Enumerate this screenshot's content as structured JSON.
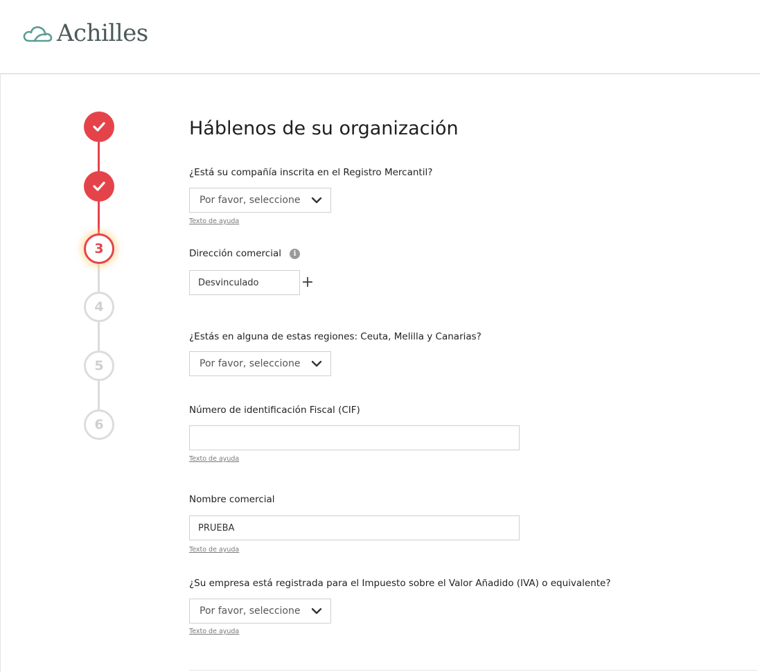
{
  "brand": {
    "name": "Achilles",
    "logo_icon": "cloud-icon",
    "accent_color": "#e5434a"
  },
  "stepper": {
    "steps": [
      {
        "label": "",
        "state": "done",
        "icon": "check-icon"
      },
      {
        "label": "",
        "state": "done",
        "icon": "check-icon"
      },
      {
        "label": "3",
        "state": "current"
      },
      {
        "label": "4",
        "state": "pending"
      },
      {
        "label": "5",
        "state": "pending"
      },
      {
        "label": "6",
        "state": "pending"
      }
    ]
  },
  "form": {
    "title": "Háblenos de su organización",
    "registro_mercantil": {
      "label": "¿Está su compañía inscrita en el Registro Mercantil?",
      "value": "Por favor, seleccione",
      "help": "Texto de ayuda"
    },
    "direccion_comercial": {
      "label": "Dirección comercial",
      "info_icon": "info-icon",
      "value": "Desvinculado",
      "add_icon": "plus-icon"
    },
    "regiones": {
      "label": "¿Estás en alguna de estas regiones: Ceuta, Melilla y Canarias?",
      "value": "Por favor, seleccione"
    },
    "cif": {
      "label": "Número de identificación Fiscal (CIF)",
      "value": "",
      "help": "Texto de ayuda"
    },
    "nombre_comercial": {
      "label": "Nombre comercial",
      "value": "PRUEBA",
      "help": "Texto de ayuda"
    },
    "iva": {
      "label": "¿Su empresa está registrada para el Impuesto sobre el Valor Añadido (IVA) o equivalente?",
      "value": "Por favor, seleccione",
      "help": "Texto de ayuda"
    }
  }
}
